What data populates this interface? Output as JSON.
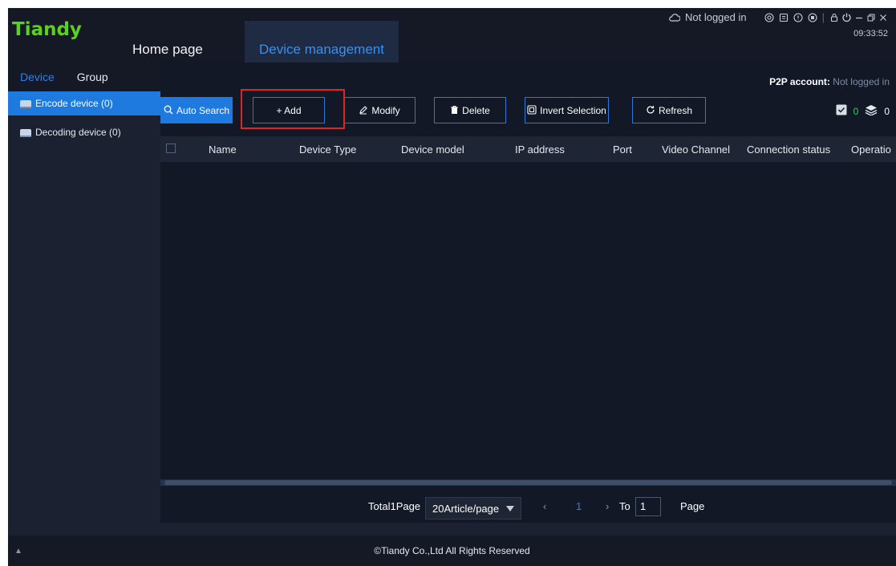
{
  "header": {
    "logo": "Tiandy",
    "tabs": [
      {
        "label": "Home page"
      },
      {
        "label": "Device management"
      }
    ],
    "status": "Not logged in",
    "time": "09:33:52"
  },
  "sidebar": {
    "tabs": [
      {
        "label": "Device"
      },
      {
        "label": "Group"
      }
    ],
    "items": [
      {
        "label": "Encode device (0)"
      },
      {
        "label": "Decoding device (0)"
      }
    ]
  },
  "main": {
    "p2p_label": "P2P account:",
    "p2p_value": "Not logged in",
    "toolbar": {
      "auto_search": "Auto Search",
      "add": "+ Add",
      "modify": "Modify",
      "delete": "Delete",
      "invert": "Invert Selection",
      "refresh": "Refresh"
    },
    "counts": {
      "checked": "0",
      "layers": "0"
    },
    "columns": [
      "Name",
      "Device Type",
      "Device model",
      "IP address",
      "Port",
      "Video Channel",
      "Connection status",
      "Operatio"
    ]
  },
  "pager": {
    "total": "Total1Page",
    "page_size": "20Article/page",
    "current": "1",
    "to_label": "To",
    "to_value": "1",
    "page_label": "Page"
  },
  "footer": {
    "copyright": "©Tiandy Co.,Ltd All Rights Reserved"
  },
  "colors": {
    "accent": "#1f7ae0",
    "logo": "#5ad21c",
    "highlight": "#e02525"
  }
}
